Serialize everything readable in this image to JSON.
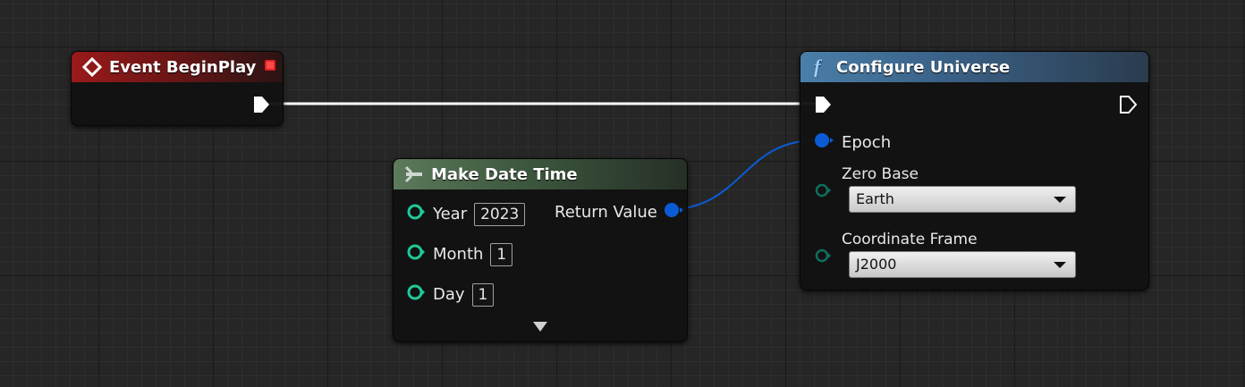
{
  "nodes": {
    "event_begin_play": {
      "title": "Event BeginPlay"
    },
    "make_date_time": {
      "title": "Make Date Time",
      "inputs": [
        {
          "label": "Year",
          "value": "2023"
        },
        {
          "label": "Month",
          "value": "1"
        },
        {
          "label": "Day",
          "value": "1"
        }
      ],
      "output_label": "Return Value"
    },
    "configure_universe": {
      "title": "Configure Universe",
      "epoch_label": "Epoch",
      "zero_base": {
        "label": "Zero Base",
        "value": "Earth"
      },
      "coordinate_frame": {
        "label": "Coordinate Frame",
        "value": "J2000"
      }
    }
  },
  "colors": {
    "exec_wire": "#ffffff",
    "struct_wire": "#0b5bd6",
    "enum_pin": "#0e6e5e"
  },
  "icons": {
    "event": "event-diamond-icon",
    "pure": "pure-function-icon",
    "function": "function-f-icon"
  }
}
